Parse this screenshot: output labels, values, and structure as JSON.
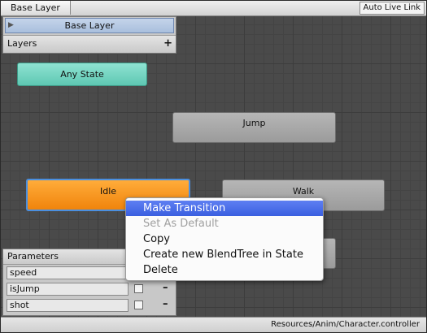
{
  "toolbar": {
    "breadcrumb": "Base Layer",
    "auto_live_link": "Auto Live Link"
  },
  "layers": {
    "items": [
      {
        "label": "Base Layer"
      }
    ],
    "header": "Layers",
    "add_symbol": "+"
  },
  "graph": {
    "states": [
      {
        "label": "Any State"
      },
      {
        "label": "Jump"
      },
      {
        "label": "Idle"
      },
      {
        "label": "Walk"
      },
      {
        "label": ""
      }
    ]
  },
  "parameters": {
    "header": "Parameters",
    "items": [
      {
        "name": "speed",
        "remove": ""
      },
      {
        "name": "isJump",
        "remove": "–"
      },
      {
        "name": "shot",
        "remove": "–"
      }
    ]
  },
  "context_menu": {
    "items": [
      {
        "label": "Make Transition"
      },
      {
        "label": "Set As Default"
      },
      {
        "label": "Copy"
      },
      {
        "label": "Create new BlendTree in State"
      },
      {
        "label": "Delete"
      }
    ]
  },
  "status": {
    "path": "Resources/Anim/Character.controller"
  },
  "colors": {
    "any_state": "#6fd3bf",
    "default_state": "#f5901a",
    "state": "#a8a8a8",
    "menu_highlight": "#4a6ee8",
    "grid_background": "#4a4a4a"
  }
}
